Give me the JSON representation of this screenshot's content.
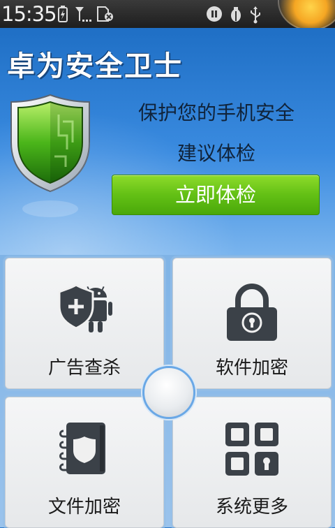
{
  "status_bar": {
    "time": "15:35",
    "icons": [
      "battery-charging-icon",
      "no-signal-icon",
      "sim-card-missing-icon",
      "media-pause-icon",
      "usb-debug-icon",
      "usb-icon"
    ]
  },
  "header": {
    "app_title": "卓为安全卫士",
    "status_line1": "保护您的手机安全",
    "status_line2": "建议体检",
    "check_button_label": "立即体检"
  },
  "grid": {
    "tiles": [
      {
        "label": "广告查杀",
        "icon": "android-shield-icon"
      },
      {
        "label": "软件加密",
        "icon": "padlock-icon"
      },
      {
        "label": "文件加密",
        "icon": "notebook-shield-icon"
      },
      {
        "label": "系统更多",
        "icon": "grid-lock-icon"
      }
    ]
  },
  "colors": {
    "accent_blue": "#2b78c9",
    "button_green": "#63c015"
  }
}
